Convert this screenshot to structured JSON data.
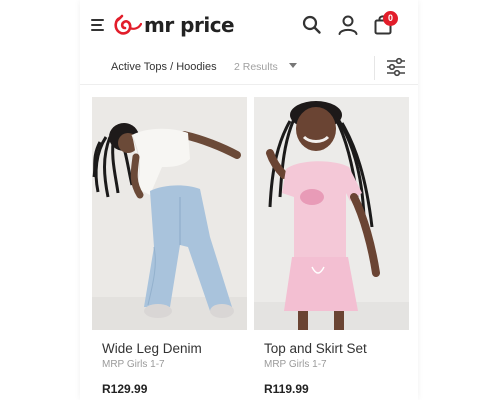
{
  "header": {
    "logo_text": "mr price",
    "bag_count": "0",
    "colors": {
      "brand_red": "#e21d2a",
      "text": "#222222"
    },
    "icons": [
      "hamburger-menu-icon",
      "search-icon",
      "account-icon",
      "shopping-bag-icon"
    ]
  },
  "filter_bar": {
    "breadcrumb": "Active Tops / Hoodies",
    "results": "2 Results",
    "icons": [
      "dropdown-caret-icon",
      "filter-sliders-icon"
    ]
  },
  "products": [
    {
      "name": "Wide Leg Denim",
      "brand": "MRP Girls 1-7",
      "price": "R129.99"
    },
    {
      "name": "Top and Skirt Set",
      "brand": "MRP Girls 1-7",
      "price": "R119.99"
    }
  ]
}
